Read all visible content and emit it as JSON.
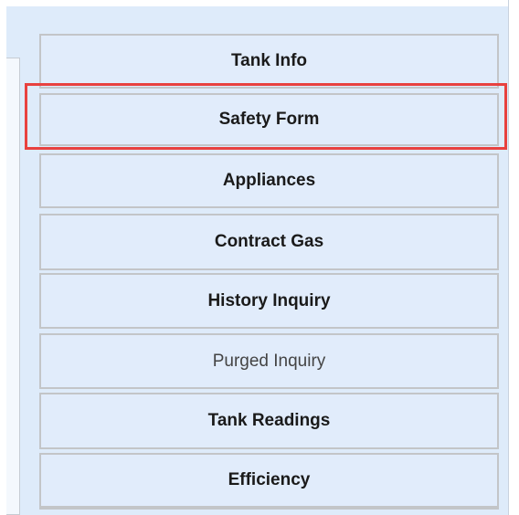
{
  "menu": {
    "items": [
      {
        "label": "Tank Info"
      },
      {
        "label": "Safety Form"
      },
      {
        "label": "Appliances"
      },
      {
        "label": "Contract Gas"
      },
      {
        "label": "History Inquiry"
      },
      {
        "label": "Purged Inquiry"
      },
      {
        "label": "Tank Readings"
      },
      {
        "label": "Efficiency"
      }
    ],
    "highlighted_item": "Safety Form"
  },
  "colors": {
    "panel_bg": "#deebfa",
    "button_bg": "#e1ecfb",
    "button_border": "#c3c5c8",
    "highlight_border": "#e8413f"
  }
}
